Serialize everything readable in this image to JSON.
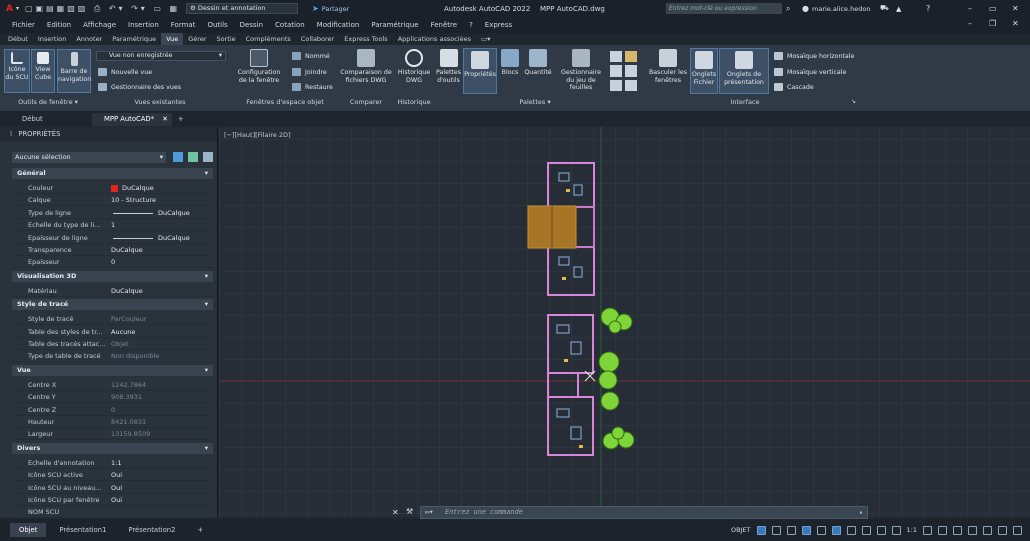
{
  "app": {
    "workspace": "Dessin et annotation",
    "share_label": "Partager",
    "title": "Autodesk AutoCAD 2022",
    "document": "MPP AutoCAD.dwg",
    "search_placeholder": "Entrez mot-clé ou expression",
    "user": "marie.alice.hedon"
  },
  "menu": [
    "Fichier",
    "Edition",
    "Affichage",
    "Insertion",
    "Format",
    "Outils",
    "Dessin",
    "Cotation",
    "Modification",
    "Paramétrique",
    "Fenêtre",
    "?",
    "Express"
  ],
  "ribbon_tabs": [
    "Début",
    "Insertion",
    "Annoter",
    "Paramétrique",
    "Vue",
    "Gérer",
    "Sortie",
    "Compléments",
    "Collaborer",
    "Express Tools",
    "Applications associées"
  ],
  "active_ribbon_tab": "Vue",
  "ribbon": {
    "icone_scu": "Icône du SCU",
    "view_cube": "View Cube",
    "barre_nav": "Barre de navigation",
    "outils_fenetre": "Outils de fenêtre",
    "vue_non_enreg": "Vue non enregistrée",
    "nouvelle_vue": "Nouvelle vue",
    "gest_vues": "Gestionnaire des vues",
    "vues_existantes": "Vues existantes",
    "config_fenetre": "Configuration de la fenêtre",
    "nomme": "Nommé",
    "joindre": "Joindre",
    "restaure": "Restaure",
    "fenetres_espace_objet": "Fenêtres d'espace objet",
    "comparaison": "Comparaison de fichiers DWG",
    "comparer": "Comparer",
    "historique_dwg": "Historique DWG",
    "historique": "Historique",
    "palettes_outils": "Palettes d'outils",
    "proprietes": "Propriétés",
    "blocs": "Blocs",
    "quantite": "Quantité",
    "gest_jeu_feuilles": "Gestionnaire du jeu de feuilles",
    "palettes": "Palettes",
    "basculer_fenetres": "Basculer les fenêtres",
    "onglets_fichier": "Onglets Fichier",
    "onglets_presentation": "Onglets de présentation",
    "mosaique_h": "Mosaïque horizontale",
    "mosaique_v": "Mosaïque verticale",
    "cascade": "Cascade",
    "interface": "Interface"
  },
  "doc_tabs": [
    "Début",
    "MPP AutoCAD*"
  ],
  "properties": {
    "title": "PROPRIÉTÉS",
    "selection": "Aucune sélection",
    "sections": [
      {
        "name": "Général",
        "rows": [
          [
            "Couleur",
            "DuCalque"
          ],
          [
            "Calque",
            "10 - Structure"
          ],
          [
            "Type de ligne",
            "DuCalque"
          ],
          [
            "Echelle du type de li...",
            "1"
          ],
          [
            "Epaisseur de ligne",
            "DuCalque"
          ],
          [
            "Transparence",
            "DuCalque"
          ],
          [
            "Epaisseur",
            "0"
          ]
        ]
      },
      {
        "name": "Visualisation 3D",
        "rows": [
          [
            "Matériau",
            "DuCalque"
          ]
        ]
      },
      {
        "name": "Style de tracé",
        "rows": [
          [
            "Style de tracé",
            "ParCouleur"
          ],
          [
            "Table des styles de tr...",
            "Aucune"
          ],
          [
            "Table des tracés attac...",
            "Objet"
          ],
          [
            "Type de table de tracé",
            "Non disponible"
          ]
        ]
      },
      {
        "name": "Vue",
        "rows": [
          [
            "Centre X",
            "1242.7864"
          ],
          [
            "Centre Y",
            "908.3931"
          ],
          [
            "Centre Z",
            "0"
          ],
          [
            "Hauteur",
            "8421.0831"
          ],
          [
            "Largeur",
            "13159.8509"
          ]
        ]
      },
      {
        "name": "Divers",
        "rows": [
          [
            "Echelle d'annotation",
            "1:1"
          ],
          [
            "Icône SCU active",
            "Oui"
          ],
          [
            "Icône SCU au niveau...",
            "Oui"
          ],
          [
            "Icône SCU par fenêtre",
            "Oui"
          ],
          [
            "NOM SCU",
            ""
          ]
        ]
      }
    ]
  },
  "viewport_label": "[−][Haut][Filaire 2D]",
  "command_placeholder": "Entrez une commande",
  "layout_tabs": [
    "Objet",
    "Présentation1",
    "Présentation2"
  ],
  "status": {
    "model": "OBJET",
    "scale": "1:1"
  },
  "colors": {
    "accent": "#3b78b5",
    "bylayer_red": "#e0261c",
    "walls": "#d884d8",
    "trees": "#7fd43a",
    "roof": "#b8862a"
  }
}
